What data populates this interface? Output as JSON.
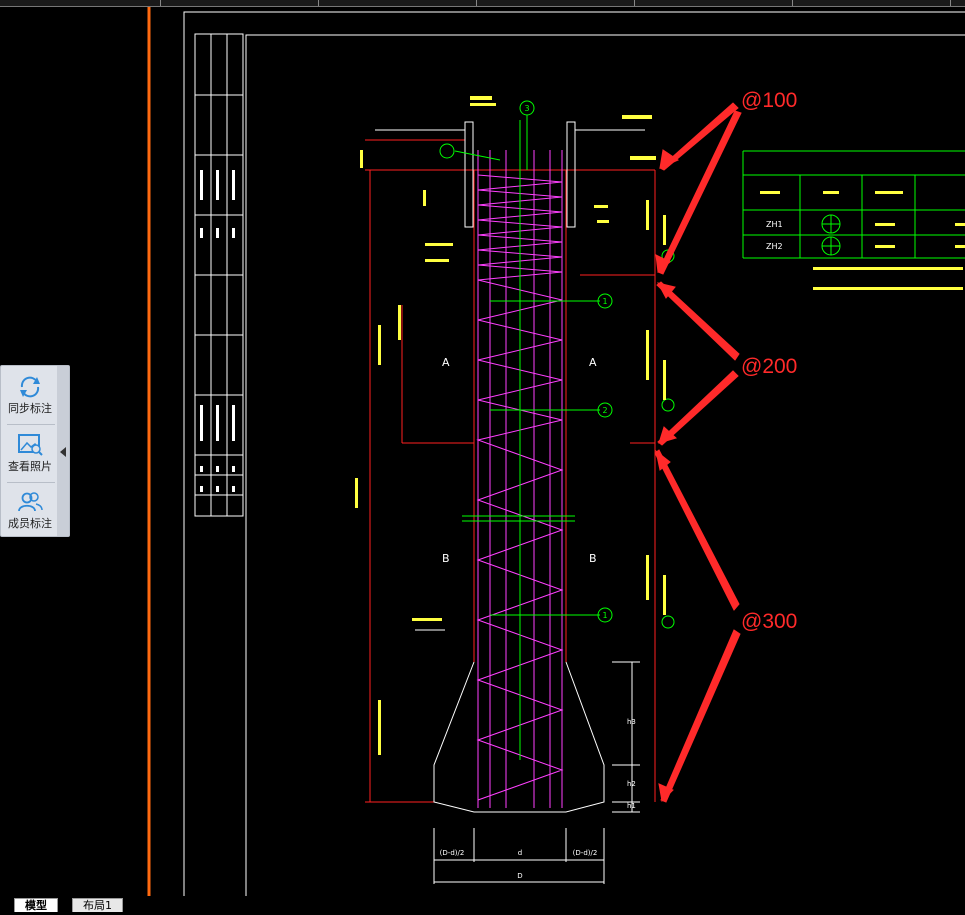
{
  "side_panel": {
    "items": [
      {
        "label": "同步标注",
        "icon": "sync-icon"
      },
      {
        "label": "查看照片",
        "icon": "photo-search-icon"
      },
      {
        "label": "成员标注",
        "icon": "members-icon"
      }
    ]
  },
  "annotations": {
    "spacing_100": "@100",
    "spacing_200": "@200",
    "spacing_300": "@300"
  },
  "drawing": {
    "section_A": "A",
    "section_B": "B",
    "callout_1": "1",
    "callout_2": "2",
    "callout_3": "3",
    "table_row_1": "ZH1",
    "table_row_2": "ZH2",
    "dim_left": "(D-d)/2",
    "dim_center": "d",
    "dim_right": "(D-d)/2",
    "dim_bottom": "D",
    "dim_h1": "h1",
    "dim_h2": "h2",
    "dim_h3": "h3"
  },
  "tabs": [
    {
      "label": "模型",
      "active": true
    },
    {
      "label": "布局1",
      "active": false
    }
  ],
  "colors": {
    "background": "#000000",
    "frame": "#ffffff",
    "pile": "#ff2020",
    "spiral": "#ff40ff",
    "rebar": "#00ff00",
    "annotation": "#ff2a2a",
    "panel_bg": "#dfe3ea",
    "panel_edge": "#ff7a1a"
  }
}
